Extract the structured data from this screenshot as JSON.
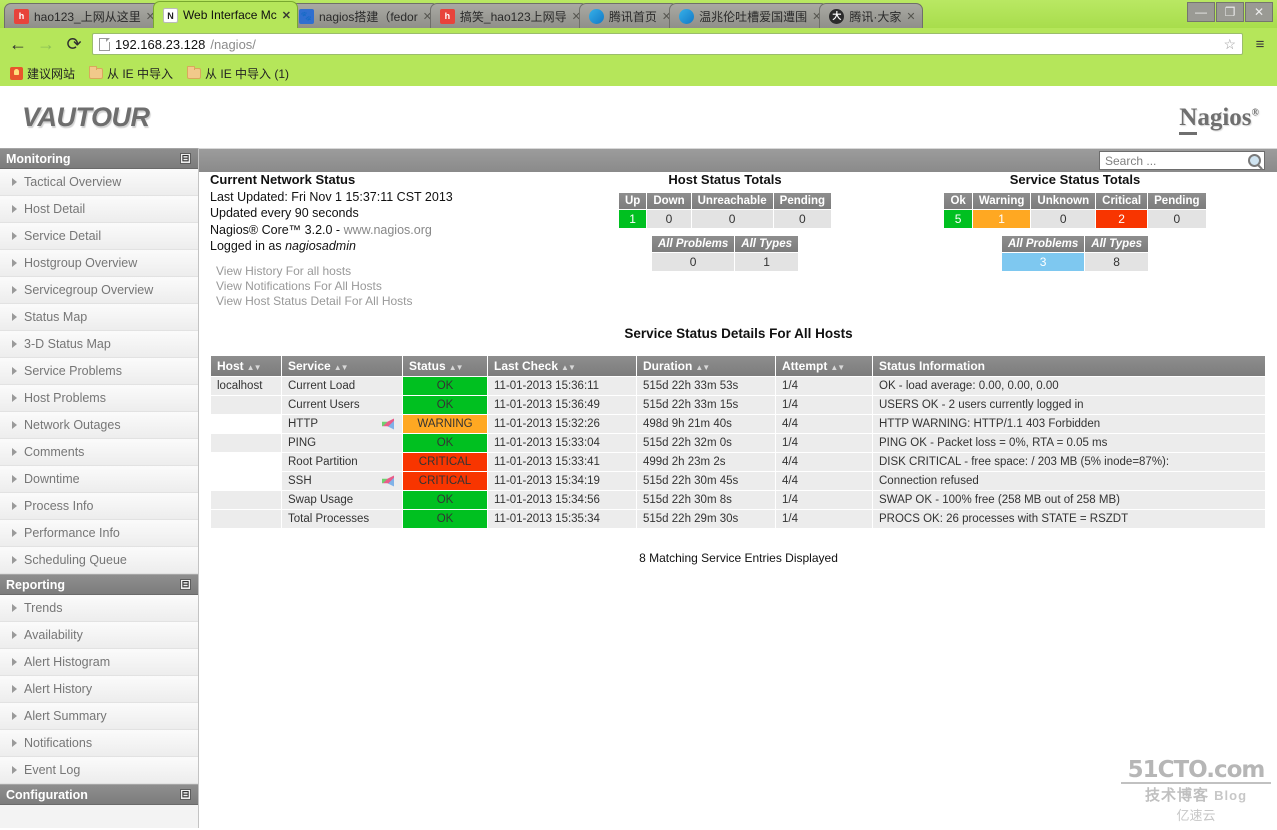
{
  "browser": {
    "tabs": [
      {
        "title": "hao123_上网从这里",
        "favicon": "hao123-favicon",
        "active": false
      },
      {
        "title": "Web Interface Mc",
        "favicon": "nagios-favicon",
        "active": true
      },
      {
        "title": "nagios搭建（fedor",
        "favicon": "paw-favicon",
        "active": false
      },
      {
        "title": "搞笑_hao123上网导",
        "favicon": "hao123-favicon",
        "active": false
      },
      {
        "title": "腾讯首页",
        "favicon": "qq-favicon",
        "active": false
      },
      {
        "title": "温兆伦吐槽爱国遭围",
        "favicon": "qq-favicon",
        "active": false
      },
      {
        "title": "腾讯·大家",
        "favicon": "qqdajia-favicon",
        "active": false
      }
    ],
    "tab_close_label": "✕",
    "window_controls": {
      "minimize": "—",
      "maximize": "❐",
      "close": "✕"
    },
    "nav": {
      "back": "←",
      "forward": "→",
      "reload": "⟳",
      "menu": "≡"
    },
    "url": {
      "host": "192.168.23.128",
      "path": "/nagios/"
    },
    "bookmark_star": "☆",
    "bookmarks": [
      {
        "label": "建议网站",
        "icon": "bulb-icon"
      },
      {
        "label": "从 IE 中导入",
        "icon": "folder-icon"
      },
      {
        "label": "从 IE 中导入 (1)",
        "icon": "folder-icon"
      }
    ]
  },
  "masthead": {
    "brand": "VAUTOUR",
    "product_prefix": "N",
    "product_rest": "agios",
    "product_reg": "®"
  },
  "search": {
    "placeholder": "Search ...",
    "value": "Search ...",
    "icon": "search-icon"
  },
  "sidebar": {
    "sections": [
      {
        "title": "Monitoring",
        "collapse": "⊟",
        "items": [
          "Tactical Overview",
          "Host Detail",
          "Service Detail",
          "Hostgroup Overview",
          "Servicegroup Overview",
          "Status Map",
          "3-D Status Map",
          "Service Problems",
          "Host Problems",
          "Network Outages",
          "Comments",
          "Downtime",
          "Process Info",
          "Performance Info",
          "Scheduling Queue"
        ]
      },
      {
        "title": "Reporting",
        "collapse": "⊟",
        "items": [
          "Trends",
          "Availability",
          "Alert Histogram",
          "Alert History",
          "Alert Summary",
          "Notifications",
          "Event Log"
        ]
      },
      {
        "title": "Configuration",
        "collapse": "⊟",
        "items": []
      }
    ]
  },
  "network_status": {
    "heading": "Current Network Status",
    "last_updated": "Last Updated: Fri Nov 1 15:37:11 CST 2013",
    "update_interval": "Updated every 90 seconds",
    "version_prefix": "Nagios® Core™ 3.2.0 - ",
    "version_link": "www.nagios.org",
    "logged_in_prefix": "Logged in as ",
    "logged_in_user": "nagiosadmin",
    "links": [
      "View History For all hosts",
      "View Notifications For All Hosts",
      "View Host Status Detail For All Hosts"
    ]
  },
  "host_totals": {
    "title": "Host Status Totals",
    "headers": [
      "Up",
      "Down",
      "Unreachable",
      "Pending"
    ],
    "values": [
      "1",
      "0",
      "0",
      "0"
    ],
    "value_styles": [
      "v-up",
      "",
      "",
      ""
    ],
    "sub_headers": [
      "All Problems",
      "All Types"
    ],
    "sub_values": [
      "0",
      "1"
    ],
    "sub_styles": [
      "",
      ""
    ]
  },
  "service_totals": {
    "title": "Service Status Totals",
    "headers": [
      "Ok",
      "Warning",
      "Unknown",
      "Critical",
      "Pending"
    ],
    "values": [
      "5",
      "1",
      "0",
      "2",
      "0"
    ],
    "value_styles": [
      "v-ok",
      "v-warn",
      "",
      "v-crit",
      ""
    ],
    "sub_headers": [
      "All Problems",
      "All Types"
    ],
    "sub_values": [
      "3",
      "8"
    ],
    "sub_styles": [
      "v-prob",
      ""
    ]
  },
  "service_details": {
    "title": "Service Status Details For All Hosts",
    "columns": [
      "Host",
      "Service",
      "Status",
      "Last Check",
      "Duration",
      "Attempt",
      "Status Information"
    ],
    "sortable": [
      true,
      true,
      true,
      true,
      true,
      true,
      false
    ],
    "sort_arrows": "▲▼",
    "rows": [
      {
        "host": "localhost",
        "service": "Current Load",
        "status": "OK",
        "status_class": "st-ok",
        "row_class": "",
        "last_check": "11-01-2013 15:36:11",
        "duration": "515d 22h 33m 53s",
        "attempt": "1/4",
        "info": "OK - load average: 0.00, 0.00, 0.00",
        "notif_disabled": false
      },
      {
        "host": "",
        "service": "Current Users",
        "status": "OK",
        "status_class": "st-ok",
        "row_class": "",
        "last_check": "11-01-2013 15:36:49",
        "duration": "515d 22h 33m 15s",
        "attempt": "1/4",
        "info": "USERS OK - 2 users currently logged in",
        "notif_disabled": false
      },
      {
        "host": "",
        "service": "HTTP",
        "status": "WARNING",
        "status_class": "st-warn",
        "row_class": "row-warn",
        "last_check": "11-01-2013 15:32:26",
        "duration": "498d 9h 21m 40s",
        "attempt": "4/4",
        "info": "HTTP WARNING: HTTP/1.1 403 Forbidden",
        "notif_disabled": true
      },
      {
        "host": "",
        "service": "PING",
        "status": "OK",
        "status_class": "st-ok",
        "row_class": "",
        "last_check": "11-01-2013 15:33:04",
        "duration": "515d 22h 32m 0s",
        "attempt": "1/4",
        "info": "PING OK - Packet loss = 0%, RTA = 0.05 ms",
        "notif_disabled": false
      },
      {
        "host": "",
        "service": "Root Partition",
        "status": "CRITICAL",
        "status_class": "st-crit",
        "row_class": "row-crit",
        "last_check": "11-01-2013 15:33:41",
        "duration": "499d 2h 23m 2s",
        "attempt": "4/4",
        "info": "DISK CRITICAL - free space: / 203 MB (5% inode=87%):",
        "notif_disabled": false
      },
      {
        "host": "",
        "service": "SSH",
        "status": "CRITICAL",
        "status_class": "st-crit",
        "row_class": "row-crit",
        "last_check": "11-01-2013 15:34:19",
        "duration": "515d 22h 30m 45s",
        "attempt": "4/4",
        "info": "Connection refused",
        "notif_disabled": true
      },
      {
        "host": "",
        "service": "Swap Usage",
        "status": "OK",
        "status_class": "st-ok",
        "row_class": "",
        "last_check": "11-01-2013 15:34:56",
        "duration": "515d 22h 30m 8s",
        "attempt": "1/4",
        "info": "SWAP OK - 100% free (258 MB out of 258 MB)",
        "notif_disabled": false
      },
      {
        "host": "",
        "service": "Total Processes",
        "status": "OK",
        "status_class": "st-ok",
        "row_class": "",
        "last_check": "11-01-2013 15:35:34",
        "duration": "515d 22h 29m 30s",
        "attempt": "1/4",
        "info": "PROCS OK: 26 processes with STATE = RSZDT",
        "notif_disabled": false
      }
    ],
    "match_count": "8 Matching Service Entries Displayed"
  },
  "watermark": {
    "line1": "51CTO.com",
    "line2": "技术博客",
    "line3": "Blog",
    "line4": "亿速云"
  },
  "colors": {
    "ok": "#00c020",
    "warning": "#ffa822",
    "critical": "#f83500",
    "problems": "#7ec8f0",
    "chrome_green": "#b5e65a",
    "header_gray": "#7c7c7c"
  }
}
